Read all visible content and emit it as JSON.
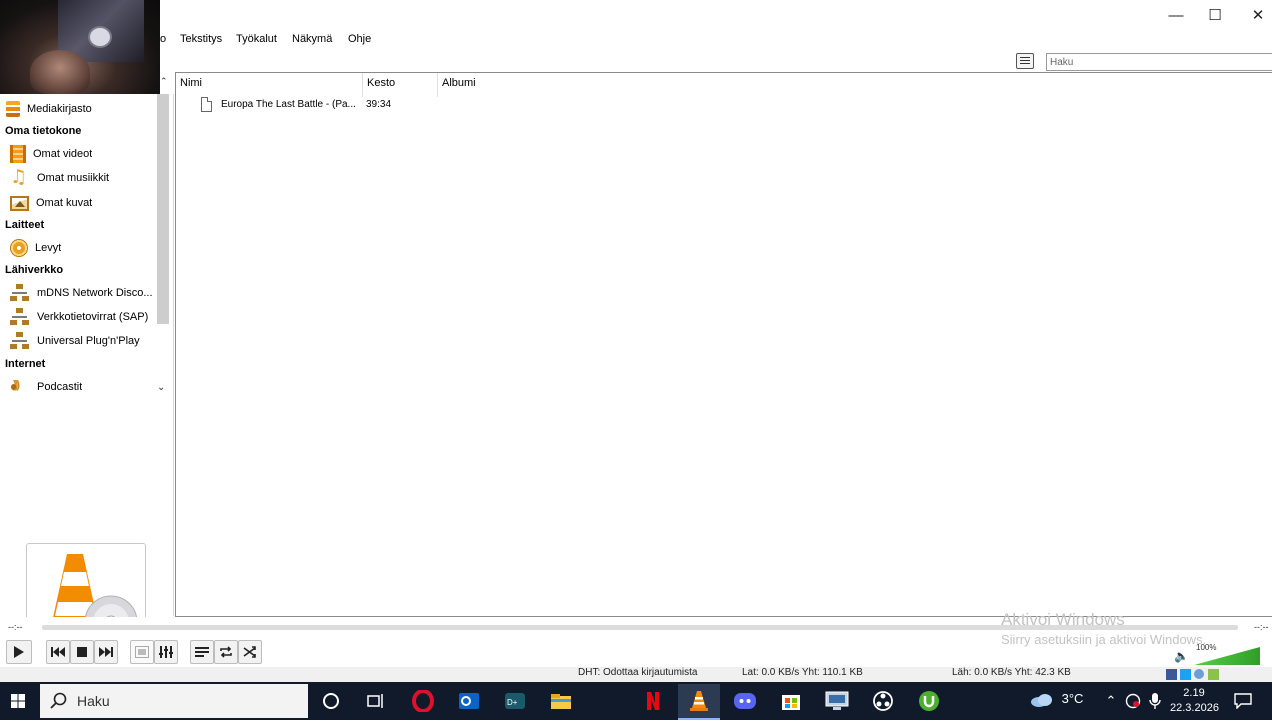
{
  "window": {
    "controls": {
      "minimize": "—",
      "maximize": "☐",
      "close": "✕"
    }
  },
  "menu": {
    "items": [
      {
        "label": "o"
      },
      {
        "label": "Tekstitys"
      },
      {
        "label": "Työkalut"
      },
      {
        "label": "Näkymä"
      },
      {
        "label": "Ohje"
      }
    ]
  },
  "search": {
    "placeholder": "Haku",
    "value": ""
  },
  "sidebar": {
    "library_label": "Mediakirjasto",
    "groups": {
      "computer": "Oma tietokone",
      "devices": "Laitteet",
      "lan": "Lähiverkko",
      "internet": "Internet"
    },
    "items": {
      "videos": "Omat videot",
      "music": "Omat musiikkit",
      "pictures": "Omat kuvat",
      "discs": "Levyt",
      "mdns": "mDNS Network Disco...",
      "sap": "Verkkotietovirrat (SAP)",
      "upnp": "Universal Plug'n'Play",
      "podcasts": "Podcastit"
    },
    "icons": {
      "library": "media-library-icon",
      "videos": "film-icon",
      "music": "music-note-icon",
      "pictures": "image-icon",
      "discs": "disc-icon",
      "network": "network-icon",
      "podcasts": "podcast-icon"
    }
  },
  "playlist": {
    "columns": [
      "Nimi",
      "Kesto",
      "Albumi"
    ],
    "rows": [
      {
        "name": "Europa The Last Battle - (Pa...",
        "duration": "39:34",
        "album": ""
      }
    ]
  },
  "player": {
    "elapsed": "--:--",
    "remaining": "--:--",
    "volume": "100%",
    "volume_level": 1.0
  },
  "watermark": {
    "title": "Aktivoi Windows",
    "subtitle": "Siirry asetuksiin ja aktivoi Windows."
  },
  "status": {
    "dht": "DHT: Odottaa kirjautumista",
    "download": "Lat: 0.0 KB/s Yht: 110.1 KB",
    "upload": "Läh: 0.0 KB/s Yht: 42.3 KB"
  },
  "taskbar": {
    "search_label": "Haku",
    "weather": "3°C",
    "time": "2.19",
    "date": "22.3.2026"
  },
  "colors": {
    "vlc_orange": "#f28c00",
    "taskbar_bg": "#101a2a",
    "volume_green": "#3fb534"
  }
}
